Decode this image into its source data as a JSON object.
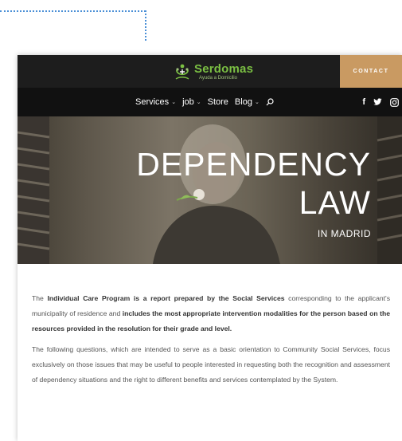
{
  "brand": {
    "name": "Serdomas",
    "tagline": "Ayuda a Domicilio",
    "accent": "#7bc043"
  },
  "header": {
    "contact_label": "CONTACT",
    "contact_color": "#c99a62"
  },
  "nav": {
    "items": [
      {
        "label": "Services",
        "has_dropdown": true
      },
      {
        "label": "job",
        "has_dropdown": true
      },
      {
        "label": "Store",
        "has_dropdown": false
      },
      {
        "label": "Blog",
        "has_dropdown": true
      }
    ],
    "search_icon": "search-icon",
    "social": [
      {
        "icon": "facebook-icon",
        "glyph": "f"
      },
      {
        "icon": "twitter-icon",
        "glyph": "t"
      },
      {
        "icon": "instagram-icon",
        "glyph": "ig"
      }
    ]
  },
  "hero": {
    "title_line1": "DEPENDENCY",
    "title_line2": "LAW",
    "subtitle": "IN MADRID"
  },
  "content": {
    "p1_a": "The ",
    "p1_b": "Individual Care Program is a report prepared by the Social Services",
    "p1_c": " corresponding to the applicant's municipality of residence and ",
    "p1_d": "includes the most appropriate intervention modalities for the person based on the resources provided in the resolution for their grade and level.",
    "p2": "The following questions, which are intended to serve as a basic orientation to Community Social Services, focus exclusively on those issues that may be useful to people interested in requesting both the recognition and assessment of dependency situations and the right to different benefits and services contemplated by the System."
  }
}
